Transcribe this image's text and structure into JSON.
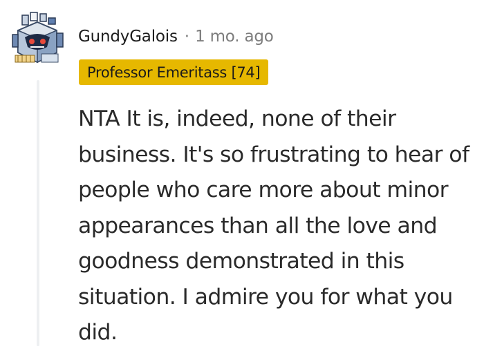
{
  "comment": {
    "username": "GundyGalois",
    "separator": "·",
    "timestamp": "1 mo. ago",
    "flair": "Professor Emeritass [74]",
    "body": "NTA It is, indeed, none of their business. It's so frustrating to hear of people who care more about minor appearances than all the love and goodness demonstrated in this situation. I admire you for what you did.",
    "avatar_icon": "robot-avatar-icon"
  },
  "colors": {
    "flair_background": "#e6b800",
    "username": "#1c1c1c",
    "timestamp": "#7c7c7c",
    "body_text": "#2a2a2a",
    "thread_line": "#edeff1"
  }
}
